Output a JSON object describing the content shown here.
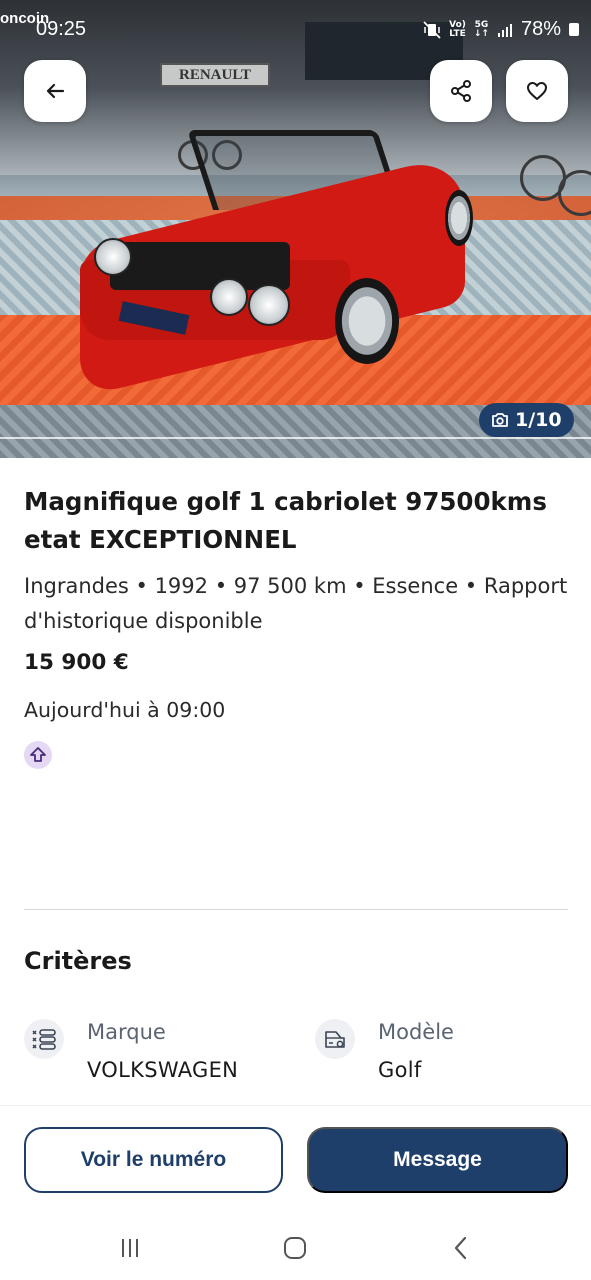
{
  "status_bar": {
    "app_peek_text": "oncoin",
    "time": "09:25",
    "network_top": "Vo)",
    "network_bottom": "LTE",
    "network_gen": "5G",
    "battery": "78%"
  },
  "gallery": {
    "counter": "1/10",
    "signs": {
      "renault": "RENAULT"
    }
  },
  "ad": {
    "title": "Magnifique golf 1 cabriolet 97500kms etat EXCEPTIONNEL",
    "meta": "Ingrandes • 1992 • 97 500 km • Essence • Rapport d'historique disponible",
    "price": "15 900 €",
    "date": "Aujourd'hui à 09:00"
  },
  "criteria": {
    "title": "Critères",
    "items": [
      {
        "label": "Marque",
        "value": "VOLKSWAGEN",
        "icon": "list-icon"
      },
      {
        "label": "Modèle",
        "value": "Golf",
        "icon": "car-model-icon"
      }
    ]
  },
  "actions": {
    "phone_label": "Voir le numéro",
    "message_label": "Message"
  },
  "colors": {
    "primary": "#1f3f6b",
    "boost_badge": "#e5d8f5"
  }
}
